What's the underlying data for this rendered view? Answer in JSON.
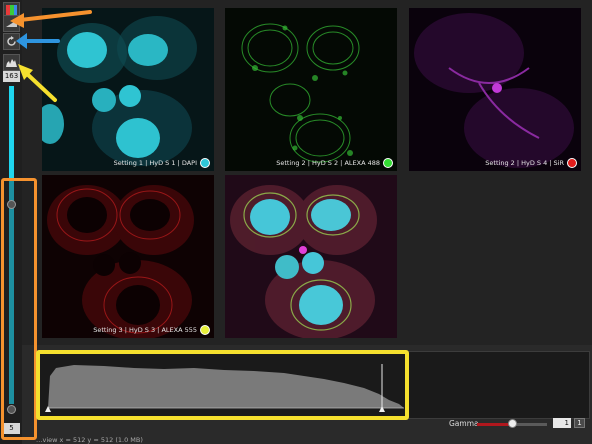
{
  "lut_panel": {
    "top_value": "163",
    "bottom_value": "5"
  },
  "channels": [
    {
      "caption": "Setting 1 | HyD S 1 | DAPI",
      "color": "#2ec7d8"
    },
    {
      "caption": "Setting 2 | HyD S 2 | ALEXA 488",
      "color": "#33dd33"
    },
    {
      "caption": "Setting 2 | HyD S 4 | SiR",
      "color": "#e21c1c"
    },
    {
      "caption": "Setting 3 | HyD S 3 | ALEXA 555",
      "color": "#e8ef3a"
    },
    {
      "caption": "",
      "color": ""
    }
  ],
  "gamma": {
    "label": "Gamma",
    "value": "1",
    "reset_label": "1",
    "level": 0.48
  },
  "status": {
    "text": "…view  x = 512  y = 512  (1.0 MB)"
  },
  "annotation_colors": {
    "orange": "#f5922e",
    "blue": "#2e95e0",
    "yellow": "#f5e02e"
  }
}
